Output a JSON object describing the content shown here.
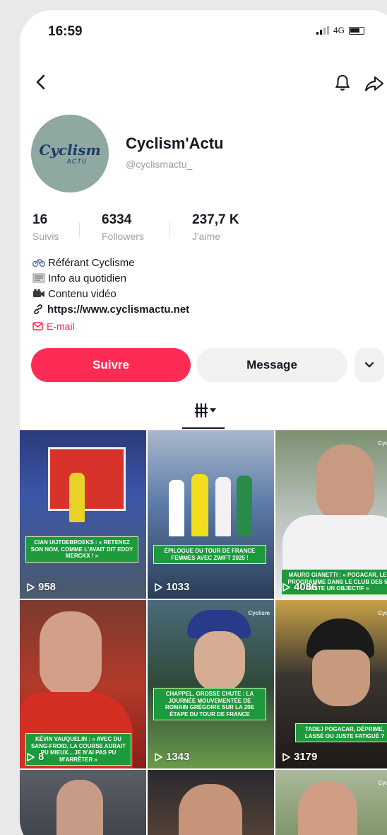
{
  "status_bar": {
    "time": "16:59",
    "network": "4G"
  },
  "profile": {
    "avatar_brand": "Cyclism",
    "avatar_sub": "ACTU",
    "display_name": "Cyclism'Actu",
    "handle": "@cyclismactu_"
  },
  "stats": [
    {
      "value": "16",
      "label": "Suivis"
    },
    {
      "value": "6334",
      "label": "Followers"
    },
    {
      "value": "237,7 K",
      "label": "J'aime"
    }
  ],
  "bio": {
    "lines": [
      "Référant Cyclisme",
      "Info au quotidien",
      "Contenu vidéo"
    ],
    "link": "https://www.cyclismactu.net",
    "email": "E-mail"
  },
  "actions": {
    "follow": "Suivre",
    "message": "Message"
  },
  "videos": [
    {
      "caption": "Cian Uijtdebroeks : « Retenez son nom, comme l'avait dit Eddy Merckx ! »",
      "views": "958",
      "bg": "#2e3f7a"
    },
    {
      "caption": "Épilogue du Tour de France Femmes avec Zwift 2025 !",
      "views": "1033",
      "bg": "#6f8fb8"
    },
    {
      "caption": "Mauro Gianetti : « Pogacar, le programme dans le club des 5 reste un objectif »",
      "views": "4086",
      "bg": "#8a9a88"
    },
    {
      "caption": "Kévin Vauquelin : « Avec du sang-froid, la course aurait pu mieux... Je n'ai pas pu m'arrêter »",
      "views": "8",
      "bg": "#9a2a1e"
    },
    {
      "caption": "Chappel, grosse chute : la journée mouvementée de Romain Grégoire sur la 20e étape du Tour de France",
      "views": "1343",
      "bg": "#3d6a4e"
    },
    {
      "caption": "Tadej Pogacar, déprime, lassé ou juste fatigué ?",
      "views": "3179",
      "bg": "#3b2a22"
    },
    {
      "caption": "",
      "views": "",
      "bg": "#4b4f56"
    },
    {
      "caption": "",
      "views": "",
      "bg": "#6b4a3a"
    },
    {
      "caption": "",
      "views": "",
      "bg": "#8fa07a"
    }
  ]
}
